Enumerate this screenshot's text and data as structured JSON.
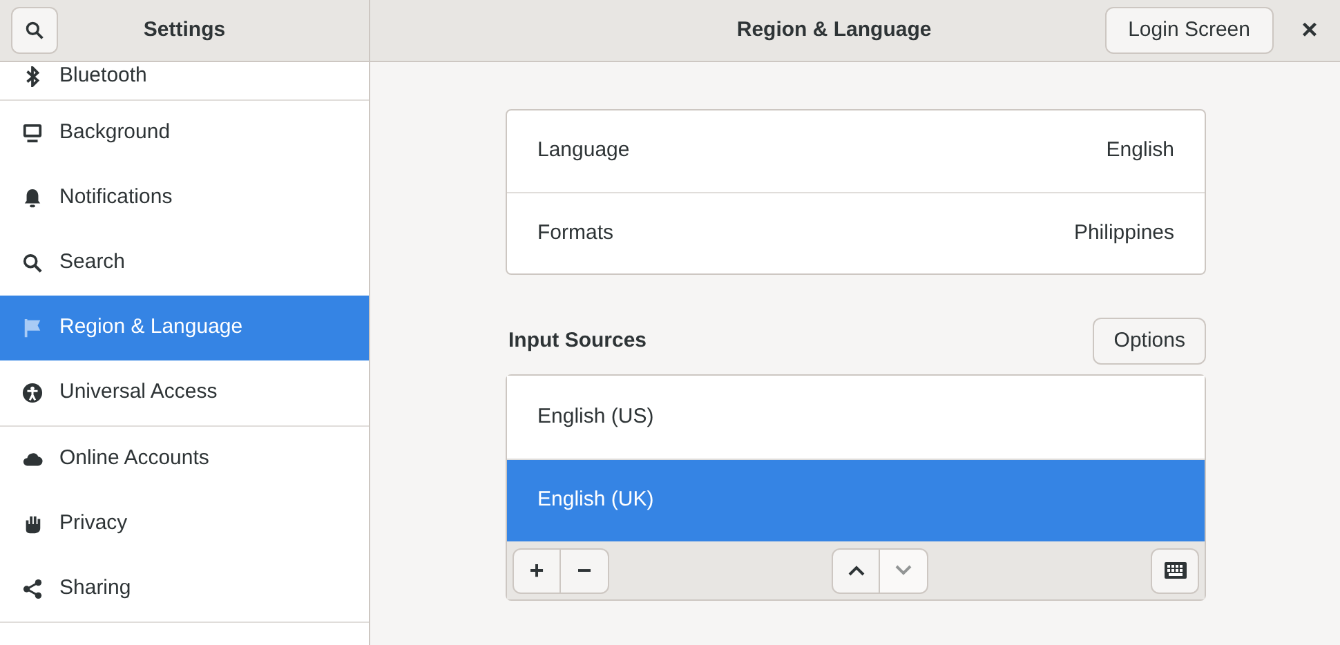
{
  "sidebar": {
    "title": "Settings",
    "groups": [
      [
        {
          "label": "Bluetooth",
          "selected": false
        }
      ],
      [
        {
          "label": "Background",
          "selected": false
        },
        {
          "label": "Notifications",
          "selected": false
        },
        {
          "label": "Search",
          "selected": false
        },
        {
          "label": "Region & Language",
          "selected": true
        },
        {
          "label": "Universal Access",
          "selected": false
        }
      ],
      [
        {
          "label": "Online Accounts",
          "selected": false
        },
        {
          "label": "Privacy",
          "selected": false
        },
        {
          "label": "Sharing",
          "selected": false
        }
      ]
    ]
  },
  "header": {
    "title": "Region & Language",
    "button": "Login Screen",
    "close": "×"
  },
  "settings": [
    {
      "label": "Language",
      "value": "English"
    },
    {
      "label": "Formats",
      "value": "Philippines"
    }
  ],
  "input_sources": {
    "heading": "Input Sources",
    "options_button": "Options",
    "items": [
      {
        "label": "English (US)",
        "selected": false
      },
      {
        "label": "English (UK)",
        "selected": true
      }
    ],
    "toolbar": {
      "add": "+",
      "remove": "−",
      "up_disabled": false,
      "down_disabled": true
    }
  }
}
